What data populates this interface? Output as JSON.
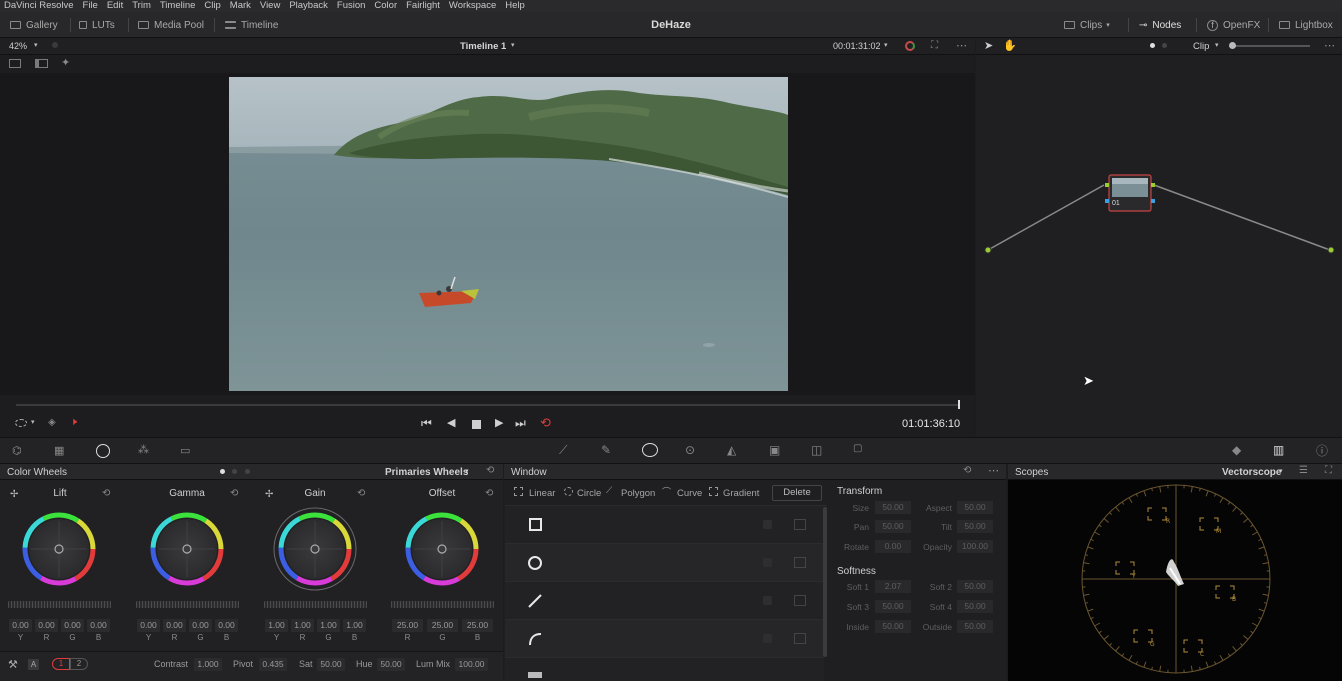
{
  "menu": [
    "DaVinci Resolve",
    "File",
    "Edit",
    "Trim",
    "Timeline",
    "Clip",
    "Mark",
    "View",
    "Playback",
    "Fusion",
    "Color",
    "Fairlight",
    "Workspace",
    "Help"
  ],
  "toolbar": {
    "gallery": "Gallery",
    "luts": "LUTs",
    "media_pool": "Media Pool",
    "timeline": "Timeline",
    "page_title": "DeHaze",
    "clips": "Clips",
    "nodes": "Nodes",
    "openfx": "OpenFX",
    "lightbox": "Lightbox"
  },
  "viewer": {
    "zoom": "42%",
    "timeline_name": "Timeline 1",
    "timecode_top": "00:01:31:02",
    "timecode": "01:01:36:10"
  },
  "node_editor": {
    "mode": "Clip",
    "node_label": "01"
  },
  "color_wheels": {
    "title": "Color Wheels",
    "mode": "Primaries Wheels",
    "wheels": [
      {
        "name": "Lift",
        "values": [
          "0.00",
          "0.00",
          "0.00",
          "0.00"
        ],
        "channels": [
          "Y",
          "R",
          "G",
          "B"
        ]
      },
      {
        "name": "Gamma",
        "values": [
          "0.00",
          "0.00",
          "0.00",
          "0.00"
        ],
        "channels": [
          "Y",
          "R",
          "G",
          "B"
        ]
      },
      {
        "name": "Gain",
        "values": [
          "1.00",
          "1.00",
          "1.00",
          "1.00"
        ],
        "channels": [
          "Y",
          "R",
          "G",
          "B"
        ]
      },
      {
        "name": "Offset",
        "values": [
          "25.00",
          "25.00",
          "25.00"
        ],
        "channels": [
          "R",
          "G",
          "B"
        ]
      }
    ],
    "footer": {
      "page1": "1",
      "page2": "2",
      "a_label": "A",
      "contrast_label": "Contrast",
      "contrast": "1.000",
      "pivot_label": "Pivot",
      "pivot": "0.435",
      "sat_label": "Sat",
      "sat": "50.00",
      "hue_label": "Hue",
      "hue": "50.00",
      "lummix_label": "Lum Mix",
      "lummix": "100.00"
    }
  },
  "window": {
    "title": "Window",
    "tools": [
      "Linear",
      "Circle",
      "Polygon",
      "Curve",
      "Gradient"
    ],
    "delete": "Delete",
    "transform_title": "Transform",
    "transform": [
      {
        "l": "Size",
        "v": "50.00",
        "l2": "Aspect",
        "v2": "50.00"
      },
      {
        "l": "Pan",
        "v": "50.00",
        "l2": "Tilt",
        "v2": "50.00"
      },
      {
        "l": "Rotate",
        "v": "0.00",
        "l2": "Opacity",
        "v2": "100.00"
      }
    ],
    "softness_title": "Softness",
    "softness": [
      {
        "l": "Soft 1",
        "v": "2.07",
        "l2": "Soft 2",
        "v2": "50.00"
      },
      {
        "l": "Soft 3",
        "v": "50.00",
        "l2": "Soft 4",
        "v2": "50.00"
      },
      {
        "l": "Inside",
        "v": "50.00",
        "l2": "Outside",
        "v2": "50.00"
      }
    ]
  },
  "scopes": {
    "title": "Scopes",
    "mode": "Vectorscope",
    "targets": [
      "R",
      "M",
      "Y",
      "B",
      "G",
      "C"
    ]
  },
  "colors": {
    "accent_red": "#e03c3c",
    "node_outline": "#c84444",
    "scope_target": "#b08a3a"
  }
}
